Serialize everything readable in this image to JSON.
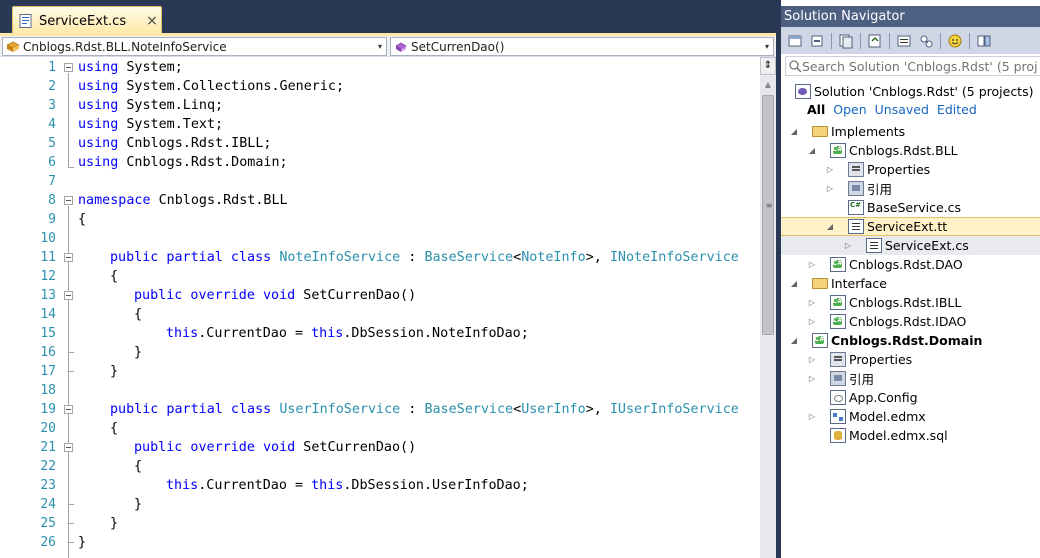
{
  "editor": {
    "tab_label": "ServiceExt.cs",
    "tab_close": "×",
    "type_combo": "Cnblogs.Rdst.BLL.NoteInfoService",
    "member_combo": "SetCurrenDao()",
    "combo_arrow": "▾",
    "split_glyph": "⇕",
    "scroll_up_glyph": "▲",
    "grip_glyph": "≡",
    "line_numbers": [
      "1",
      "2",
      "3",
      "4",
      "5",
      "6",
      "7",
      "8",
      "9",
      "10",
      "11",
      "12",
      "13",
      "14",
      "15",
      "16",
      "17",
      "18",
      "19",
      "20",
      "21",
      "22",
      "23",
      "24",
      "25",
      "26"
    ],
    "code": {
      "l1_kw": "using",
      "l1_rest": " System;",
      "l2_kw": "using",
      "l2_rest": " System.Collections.Generic;",
      "l3_kw": "using",
      "l3_rest": " System.Linq;",
      "l4_kw": "using",
      "l4_rest": " System.Text;",
      "l5_kw": "using",
      "l5_rest": " Cnblogs.Rdst.IBLL;",
      "l6_kw": "using",
      "l6_rest": " Cnblogs.Rdst.Domain;",
      "l8_kw": "namespace",
      "l8_rest": " Cnblogs.Rdst.BLL",
      "l9": "{",
      "l11_kw": "public partial class",
      "l11_sp": " ",
      "l11_ty1": "NoteInfoService",
      "l11_colon": " : ",
      "l11_ty2": "BaseService",
      "l11_lt": "<",
      "l11_ty3": "NoteInfo",
      "l11_gt": ">, ",
      "l11_ty4": "INoteInfoService",
      "l12": "{",
      "l13_kw": "public override void",
      "l13_rest": " SetCurrenDao()",
      "l14": "{",
      "l15_kw1": "this",
      "l15_mid": ".CurrentDao = ",
      "l15_kw2": "this",
      "l15_rest": ".DbSession.NoteInfoDao;",
      "l16": "}",
      "l17": "}",
      "l19_kw": "public partial class",
      "l19_sp": " ",
      "l19_ty1": "UserInfoService",
      "l19_colon": " : ",
      "l19_ty2": "BaseService",
      "l19_lt": "<",
      "l19_ty3": "UserInfo",
      "l19_gt": ">, ",
      "l19_ty4": "IUserInfoService",
      "l20": "{",
      "l21_kw": "public override void",
      "l21_rest": " SetCurrenDao()",
      "l22": "{",
      "l23_kw1": "this",
      "l23_mid": ".CurrentDao = ",
      "l23_kw2": "this",
      "l23_rest": ".DbSession.UserInfoDao;",
      "l24": "}",
      "l25": "}",
      "l26": "}"
    }
  },
  "solution": {
    "title": "Solution Navigator",
    "search_placeholder": "Search Solution 'Cnblogs.Rdst' (5 projects)",
    "solution_label": "Solution 'Cnblogs.Rdst' (5 projects)",
    "filters": {
      "all": "All",
      "open": "Open",
      "unsaved": "Unsaved",
      "edited": "Edited"
    },
    "tree": {
      "implements": "Implements",
      "bll": "Cnblogs.Rdst.BLL",
      "properties1": "Properties",
      "ref1": "引用",
      "baseservice": "BaseService.cs",
      "serviceext_tt": "ServiceExt.tt",
      "serviceext_cs": "ServiceExt.cs",
      "dao": "Cnblogs.Rdst.DAO",
      "interface": "Interface",
      "ibll": "Cnblogs.Rdst.IBLL",
      "idao": "Cnblogs.Rdst.IDAO",
      "domain": "Cnblogs.Rdst.Domain",
      "properties2": "Properties",
      "ref2": "引用",
      "appconfig": "App.Config",
      "edmx": "Model.edmx",
      "edmxsql": "Model.edmx.sql"
    },
    "expanded_glyph": "◢",
    "collapsed_glyph": "▷"
  }
}
